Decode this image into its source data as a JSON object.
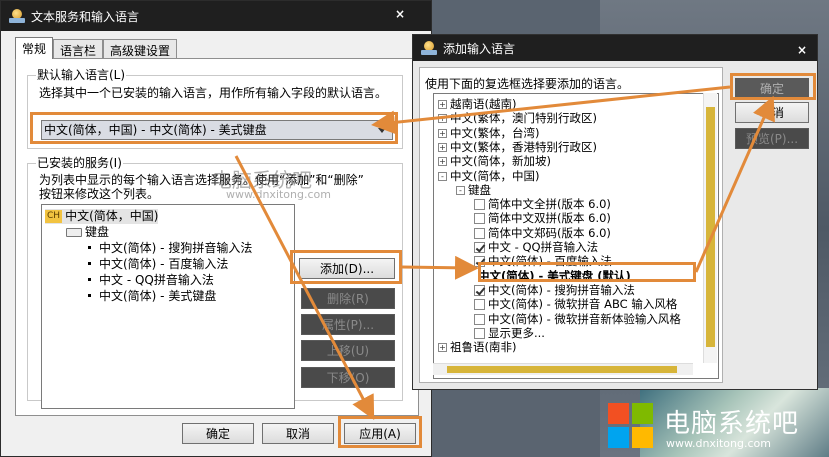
{
  "main_window": {
    "title": "文本服务和输入语言",
    "close": "×",
    "tabs": [
      "常规",
      "语言栏",
      "高级键设置"
    ],
    "default_group": {
      "legend": "默认输入语言(L)",
      "desc": "选择其中一个已安装的输入语言，用作所有输入字段的默认语言。",
      "selected": "中文(简体，中国) - 中文(简体) - 美式键盘"
    },
    "installed_group": {
      "legend": "已安装的服务(I)",
      "desc_line1": "为列表中显示的每个输入语言选择服务。使用“添加”和“删除”",
      "desc_line2": "按钮来修改这个列表。",
      "lang_code": "CH",
      "language": "中文(简体，中国)",
      "keyboard": "键盘",
      "items": [
        "中文(简体) - 搜狗拼音输入法",
        "中文(简体) - 百度输入法",
        "中文 - QQ拼音输入法",
        "中文(简体) - 美式键盘"
      ]
    },
    "buttons": {
      "add": "添加(D)...",
      "remove": "删除(R)",
      "properties": "属性(P)...",
      "up": "上移(U)",
      "down": "下移(O)",
      "ok": "确定",
      "cancel": "取消",
      "apply": "应用(A)"
    }
  },
  "add_window": {
    "title": "添加输入语言",
    "close": "×",
    "instruction": "使用下面的复选框选择要添加的语言。",
    "tree": [
      {
        "indent": 0,
        "toggle": "+",
        "text": "越南语(越南)"
      },
      {
        "indent": 0,
        "toggle": "+",
        "text": "中文(繁体，澳门特别行政区)"
      },
      {
        "indent": 0,
        "toggle": "+",
        "text": "中文(繁体，台湾)"
      },
      {
        "indent": 0,
        "toggle": "+",
        "text": "中文(繁体，香港特别行政区)"
      },
      {
        "indent": 0,
        "toggle": "+",
        "text": "中文(简体，新加坡)"
      },
      {
        "indent": 0,
        "toggle": "-",
        "text": "中文(简体，中国)"
      },
      {
        "indent": 1,
        "toggle": "-",
        "text": "键盘"
      },
      {
        "indent": 2,
        "check": false,
        "text": "简体中文全拼(版本 6.0)"
      },
      {
        "indent": 2,
        "check": false,
        "text": "简体中文双拼(版本 6.0)"
      },
      {
        "indent": 2,
        "check": false,
        "text": "简体中文郑码(版本 6.0)"
      },
      {
        "indent": 2,
        "check": true,
        "text": "中文 - QQ拼音输入法"
      },
      {
        "indent": 2,
        "check": true,
        "text": "中文(简体) - 百度输入法"
      },
      {
        "indent": 2,
        "bold": true,
        "text": "中文(简体) - 美式键盘 (默认)"
      },
      {
        "indent": 2,
        "check": true,
        "text": "中文(简体) - 搜狗拼音输入法"
      },
      {
        "indent": 2,
        "check": false,
        "text": "中文(简体) - 微软拼音 ABC 输入风格"
      },
      {
        "indent": 2,
        "check": false,
        "text": "中文(简体) - 微软拼音新体验输入风格"
      },
      {
        "indent": 2,
        "check": false,
        "text": "显示更多..."
      },
      {
        "indent": 0,
        "toggle": "+",
        "text": "祖鲁语(南非)"
      }
    ],
    "buttons": {
      "ok": "确定",
      "cancel": "取消",
      "preview": "预览(P)..."
    }
  },
  "watermark": {
    "text": "电脑系统吧",
    "url": "www.dnxitong.com"
  },
  "logo": {
    "text": "电脑系统吧",
    "url": "www.dnxitong.com",
    "colors": [
      "#f25022",
      "#7fba00",
      "#00a4ef",
      "#ffb900"
    ]
  },
  "accent_color": "#e28a3a"
}
